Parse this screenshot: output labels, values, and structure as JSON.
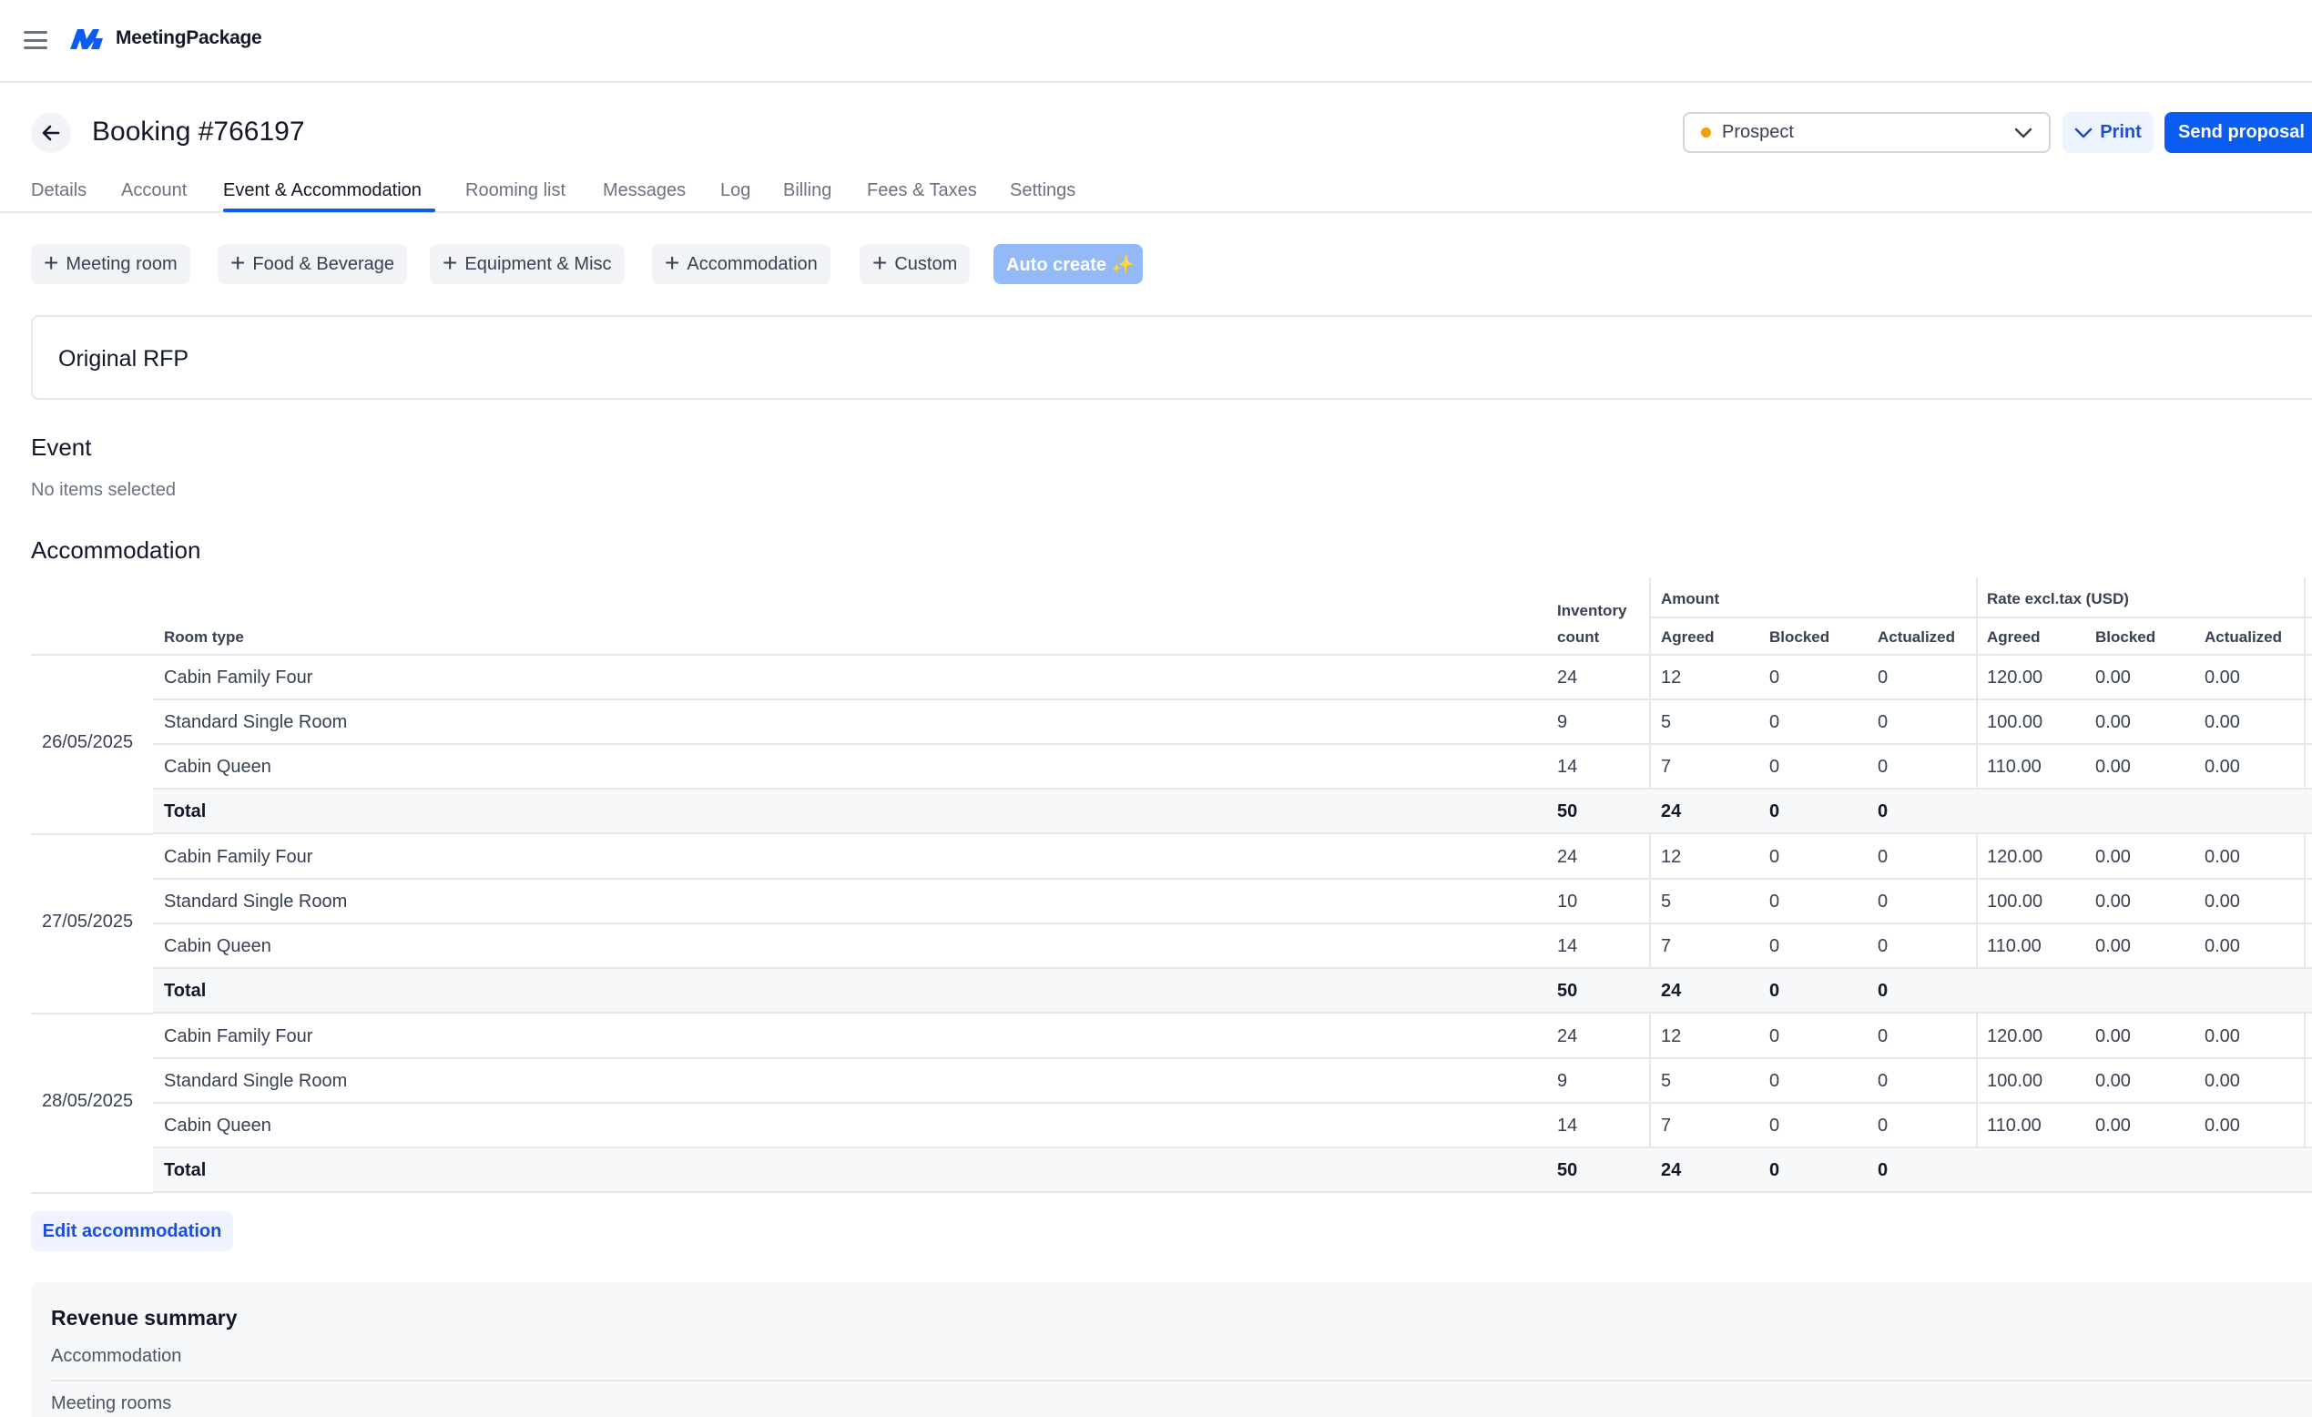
{
  "brand": {
    "name": "MeetingPackage",
    "accent": "#0b5cf0"
  },
  "header": {
    "title": "Booking #766197",
    "status": {
      "value": "Prospect",
      "dot_color": "#f59e0b"
    },
    "print_label": "Print",
    "send_label": "Send proposal"
  },
  "tabs": [
    {
      "label": "Details"
    },
    {
      "label": "Account"
    },
    {
      "label": "Event & Accommodation",
      "active": true
    },
    {
      "label": "Rooming list"
    },
    {
      "label": "Messages"
    },
    {
      "label": "Log"
    },
    {
      "label": "Billing"
    },
    {
      "label": "Fees & Taxes"
    },
    {
      "label": "Settings"
    }
  ],
  "add_buttons": [
    {
      "label": "Meeting room"
    },
    {
      "label": "Food & Beverage"
    },
    {
      "label": "Equipment & Misc"
    },
    {
      "label": "Accommodation"
    },
    {
      "label": "Custom"
    }
  ],
  "auto_create_label": "Auto create ✨",
  "rfp": {
    "title": "Original RFP"
  },
  "event": {
    "title": "Event",
    "empty_text": "No items selected"
  },
  "accommodation": {
    "title": "Accommodation",
    "headers": {
      "room_type": "Room type",
      "inventory_line1": "Inventory",
      "inventory_line2": "count",
      "amount": "Amount",
      "rate": "Rate excl.tax (USD)",
      "agreed": "Agreed",
      "blocked": "Blocked",
      "actualized": "Actualized"
    },
    "groups": [
      {
        "date": "26/05/2025",
        "rows": [
          {
            "room": "Cabin Family Four",
            "inventory": "24",
            "agreed": "12",
            "blocked": "0",
            "actualized": "0",
            "rate_agreed": "120.00",
            "rate_blocked": "0.00",
            "rate_actualized": "0.00"
          },
          {
            "room": "Standard Single Room",
            "inventory": "9",
            "agreed": "5",
            "blocked": "0",
            "actualized": "0",
            "rate_agreed": "100.00",
            "rate_blocked": "0.00",
            "rate_actualized": "0.00"
          },
          {
            "room": "Cabin Queen",
            "inventory": "14",
            "agreed": "7",
            "blocked": "0",
            "actualized": "0",
            "rate_agreed": "110.00",
            "rate_blocked": "0.00",
            "rate_actualized": "0.00"
          }
        ],
        "total": {
          "label": "Total",
          "inventory": "50",
          "agreed": "24",
          "blocked": "0",
          "actualized": "0"
        }
      },
      {
        "date": "27/05/2025",
        "rows": [
          {
            "room": "Cabin Family Four",
            "inventory": "24",
            "agreed": "12",
            "blocked": "0",
            "actualized": "0",
            "rate_agreed": "120.00",
            "rate_blocked": "0.00",
            "rate_actualized": "0.00"
          },
          {
            "room": "Standard Single Room",
            "inventory": "10",
            "agreed": "5",
            "blocked": "0",
            "actualized": "0",
            "rate_agreed": "100.00",
            "rate_blocked": "0.00",
            "rate_actualized": "0.00"
          },
          {
            "room": "Cabin Queen",
            "inventory": "14",
            "agreed": "7",
            "blocked": "0",
            "actualized": "0",
            "rate_agreed": "110.00",
            "rate_blocked": "0.00",
            "rate_actualized": "0.00"
          }
        ],
        "total": {
          "label": "Total",
          "inventory": "50",
          "agreed": "24",
          "blocked": "0",
          "actualized": "0"
        }
      },
      {
        "date": "28/05/2025",
        "rows": [
          {
            "room": "Cabin Family Four",
            "inventory": "24",
            "agreed": "12",
            "blocked": "0",
            "actualized": "0",
            "rate_agreed": "120.00",
            "rate_blocked": "0.00",
            "rate_actualized": "0.00"
          },
          {
            "room": "Standard Single Room",
            "inventory": "9",
            "agreed": "5",
            "blocked": "0",
            "actualized": "0",
            "rate_agreed": "100.00",
            "rate_blocked": "0.00",
            "rate_actualized": "0.00"
          },
          {
            "room": "Cabin Queen",
            "inventory": "14",
            "agreed": "7",
            "blocked": "0",
            "actualized": "0",
            "rate_agreed": "110.00",
            "rate_blocked": "0.00",
            "rate_actualized": "0.00"
          }
        ],
        "total": {
          "label": "Total",
          "inventory": "50",
          "agreed": "24",
          "blocked": "0",
          "actualized": "0"
        }
      }
    ],
    "edit_label": "Edit accommodation"
  },
  "revenue_summary": {
    "title": "Revenue summary",
    "items": [
      "Accommodation",
      "Meeting rooms"
    ]
  }
}
